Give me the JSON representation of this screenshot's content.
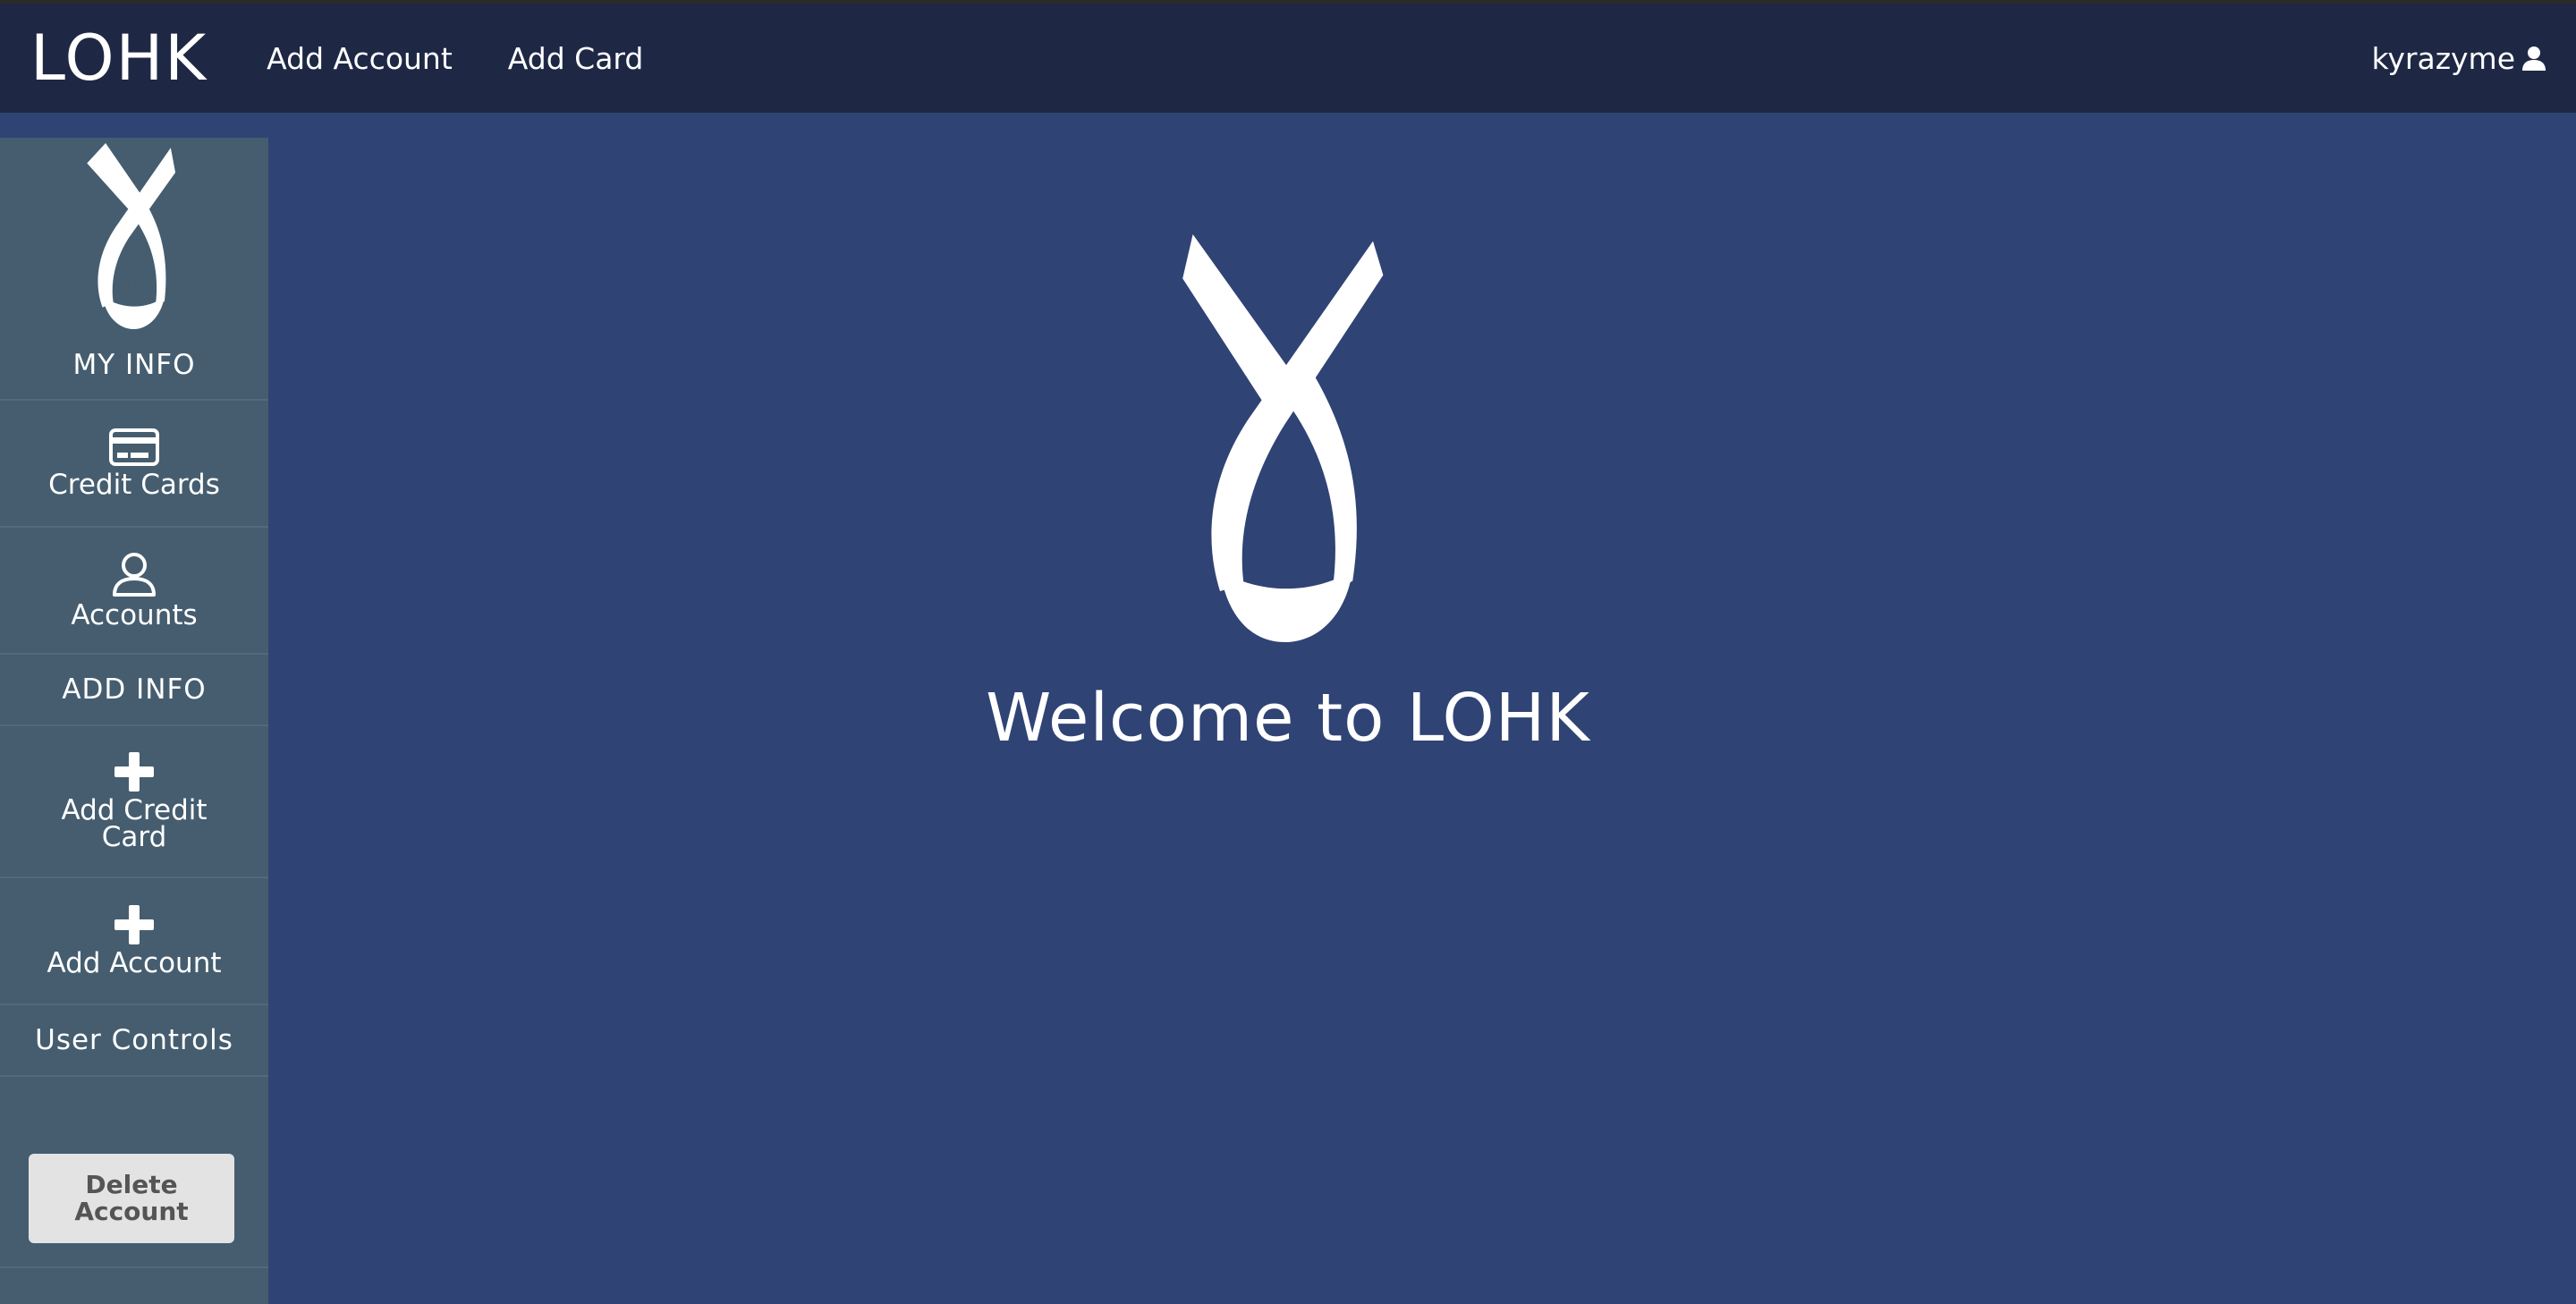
{
  "navbar": {
    "brand": "LOHK",
    "links": [
      "Add Account",
      "Add Card"
    ],
    "username": "kyrazyme",
    "user_icon": "user-icon"
  },
  "sidebar": {
    "logo": "lohk-ribbon-logo",
    "my_info_heading": "MY INFO",
    "credit_cards": {
      "label": "Credit Cards",
      "icon": "credit-card-icon"
    },
    "accounts": {
      "label": "Accounts",
      "icon": "user-outline-icon"
    },
    "add_info_heading": "ADD INFO",
    "add_credit_card": {
      "label": "Add Credit Card",
      "icon": "plus-icon"
    },
    "add_account": {
      "label": "Add Account",
      "icon": "plus-icon"
    },
    "user_controls_heading": "User Controls",
    "delete_account_button": "Delete Account"
  },
  "main": {
    "logo": "lohk-ribbon-logo",
    "welcome_text": "Welcome to LOHK"
  },
  "colors": {
    "navbar_bg": "#1e2845",
    "page_bg": "#2f4374",
    "sidebar_bg": "#455d6f",
    "button_bg": "#e3e3e3"
  }
}
